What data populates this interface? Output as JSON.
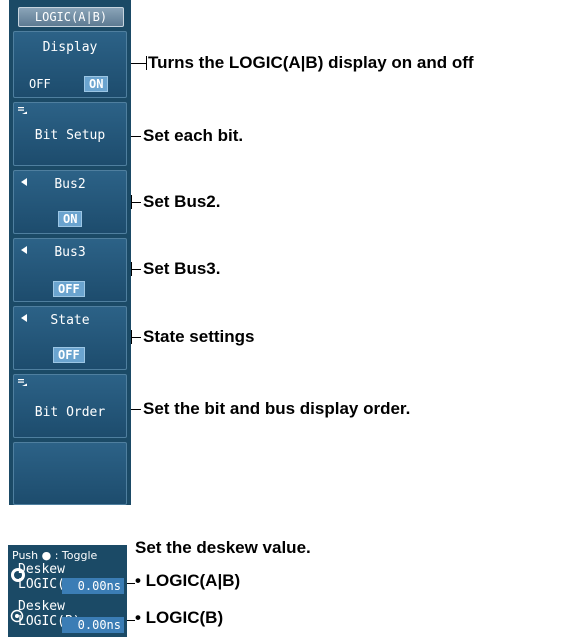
{
  "panel": {
    "title": "LOGIC(A|B)",
    "display": {
      "label": "Display",
      "off": "OFF",
      "on": "ON"
    },
    "bit_setup": {
      "label": "Bit Setup"
    },
    "bus2": {
      "label": "Bus2",
      "state": "ON"
    },
    "bus3": {
      "label": "Bus3",
      "state": "OFF"
    },
    "state": {
      "label": "State",
      "state": "OFF"
    },
    "bit_order": {
      "label": "Bit Order"
    }
  },
  "annotations": {
    "display": "Turns the LOGIC(A|B) display on and off",
    "bit_setup": "Set each bit.",
    "bus2": "Set Bus2.",
    "bus3": "Set Bus3.",
    "state": "State settings",
    "bit_order": "Set the bit and bus display order.",
    "deskew_title": "Set the deskew value.",
    "deskew_a": "• LOGIC(A|B)",
    "deskew_b": "• LOGIC(B)"
  },
  "deskew_panel": {
    "hint": "Push ● : Toggle",
    "row_a_label": "Deskew LOGIC(A)",
    "row_a_value": "0.00ns",
    "row_b_label": "Deskew LOGIC(B)",
    "row_b_value": "0.00ns"
  },
  "colors": {
    "panel_bg": "#1b4a66",
    "on_highlight": "#6ba4cf",
    "value_bg": "#3b7db5"
  }
}
